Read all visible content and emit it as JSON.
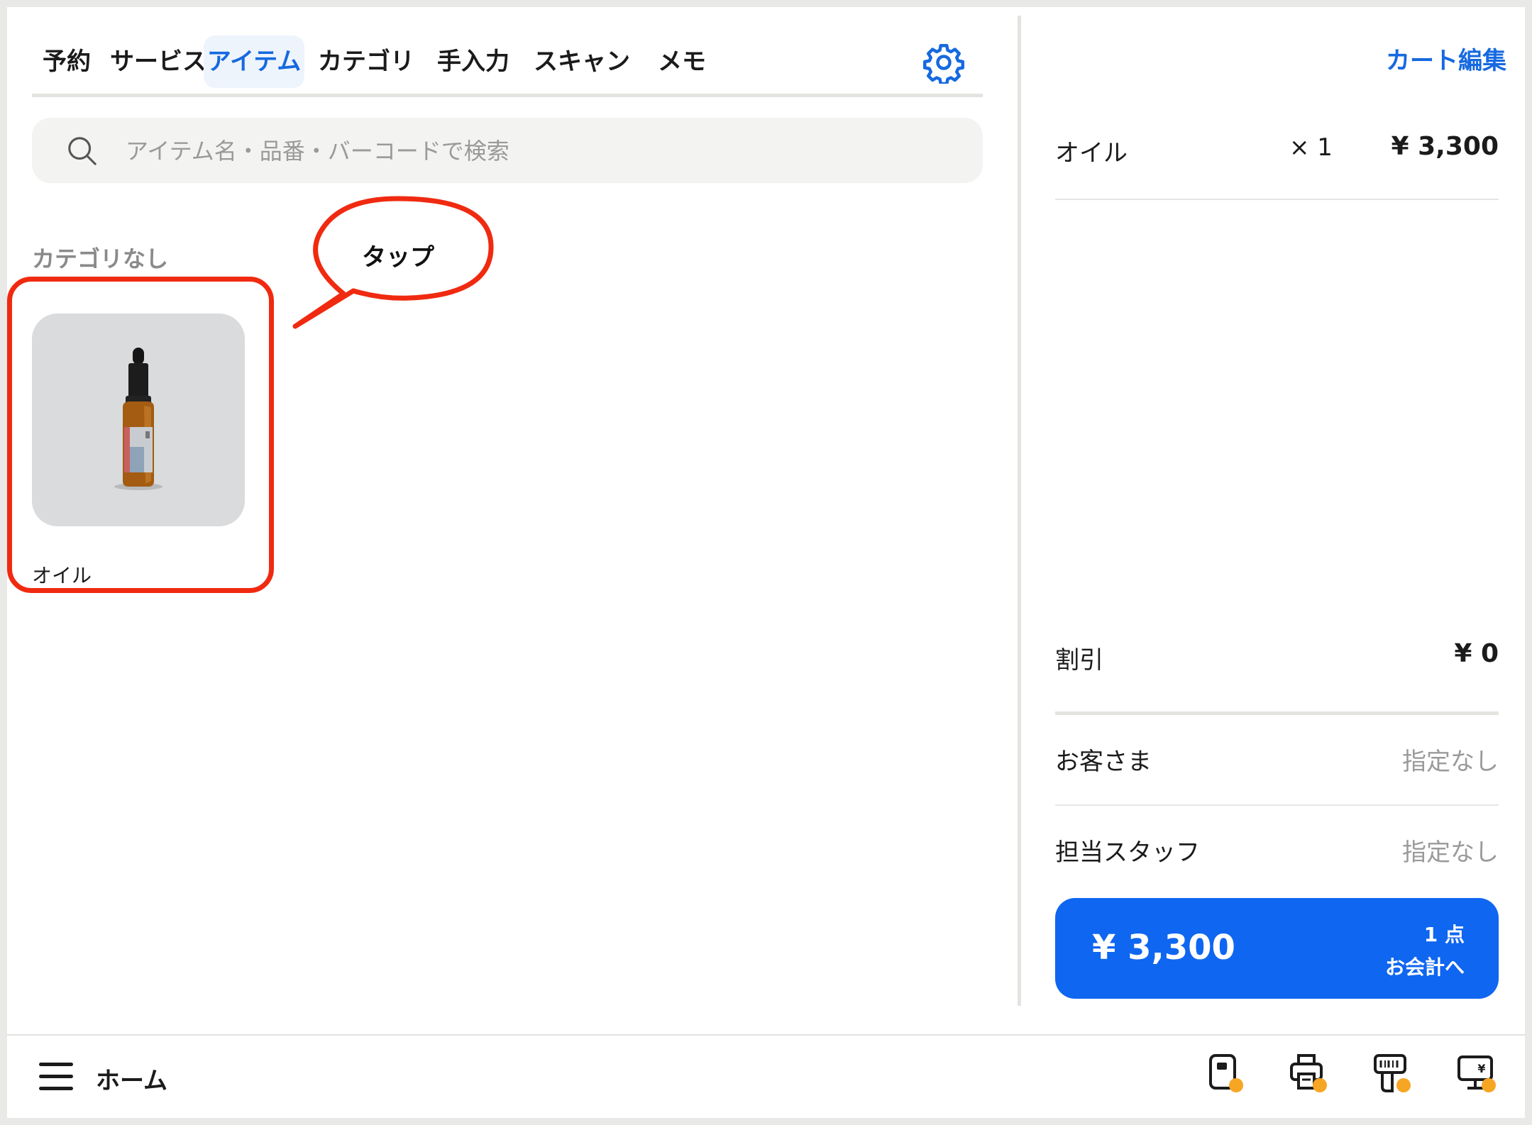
{
  "tabs": [
    {
      "label": "予約"
    },
    {
      "label": "サービス"
    },
    {
      "label": "アイテム",
      "active": true
    },
    {
      "label": "カテゴリ"
    },
    {
      "label": "手入力"
    },
    {
      "label": "スキャン"
    },
    {
      "label": "メモ"
    }
  ],
  "search": {
    "placeholder": "アイテム名・品番・バーコードで検索"
  },
  "section": {
    "title": "カテゴリなし"
  },
  "item": {
    "name": "オイル"
  },
  "annotation": {
    "label": "タップ"
  },
  "cart": {
    "edit_label": "カート編集",
    "items": [
      {
        "name": "オイル",
        "qty": "× 1",
        "price": "¥ 3,300"
      }
    ],
    "discount": {
      "label": "割引",
      "value": "¥ 0"
    },
    "customer": {
      "label": "お客さま",
      "value": "指定なし"
    },
    "staff": {
      "label": "担当スタッフ",
      "value": "指定なし"
    },
    "checkout": {
      "amount": "¥ 3,300",
      "count": "1 点",
      "cta": "お会計へ"
    }
  },
  "bottom": {
    "home_label": "ホーム"
  },
  "colors": {
    "accent": "#1669e0",
    "checkout": "#0f66f0",
    "highlight": "#f02a10",
    "status_dot": "#f6a623"
  },
  "icons": [
    "settings-gear-icon",
    "search-icon",
    "menu-icon",
    "card-reader-icon",
    "printer-icon",
    "barcode-scanner-icon",
    "customer-display-icon"
  ]
}
